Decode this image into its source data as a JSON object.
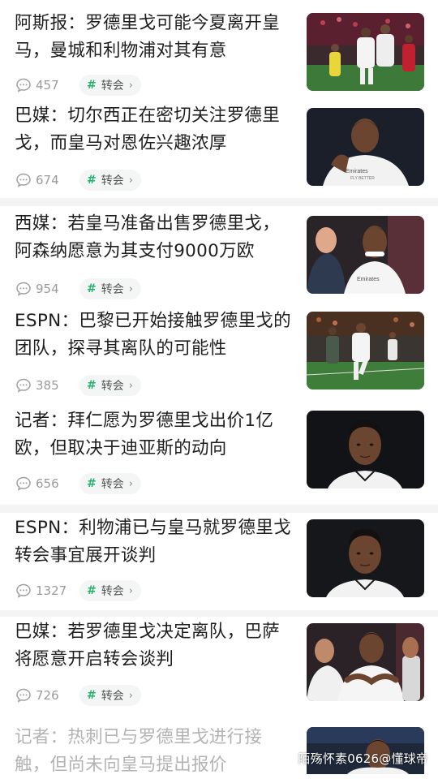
{
  "feed": {
    "items": [
      {
        "title": "阿斯报：罗德里戈可能今夏离开皇马，曼城和利物浦对其有意",
        "comments": "457",
        "tag": "转会"
      },
      {
        "title": "巴媒：切尔西正在密切关注罗德里戈，而皇马对恩佐兴趣浓厚",
        "comments": "674",
        "tag": "转会"
      },
      {
        "title": "西媒：若皇马准备出售罗德里戈，阿森纳愿意为其支付9000万欧",
        "comments": "954",
        "tag": "转会"
      },
      {
        "title": "ESPN：巴黎已开始接触罗德里戈的团队，探寻其离队的可能性",
        "comments": "385",
        "tag": "转会"
      },
      {
        "title": "记者：拜仁愿为罗德里戈出价1亿欧，但取决于迪亚斯的动向",
        "comments": "656",
        "tag": "转会"
      },
      {
        "title": "ESPN：利物浦已与皇马就罗德里戈转会事宜展开谈判",
        "comments": "1327",
        "tag": "转会"
      },
      {
        "title": "巴媒：若罗德里戈决定离队，巴萨将愿意开启转会谈判",
        "comments": "726",
        "tag": "转会"
      },
      {
        "title": "记者：热刺已与罗德里戈进行接触，但尚未向皇马提出报价"
      }
    ]
  },
  "jersey_text": {
    "emirates": "Emirates",
    "fly_better": "FLY BETTER"
  },
  "watermark": "陌殇怀素0626@懂球帝",
  "colors": {
    "accent_green": "#23b26d",
    "meta_gray": "#9a9a9a",
    "divider": "#f4f4f4"
  }
}
